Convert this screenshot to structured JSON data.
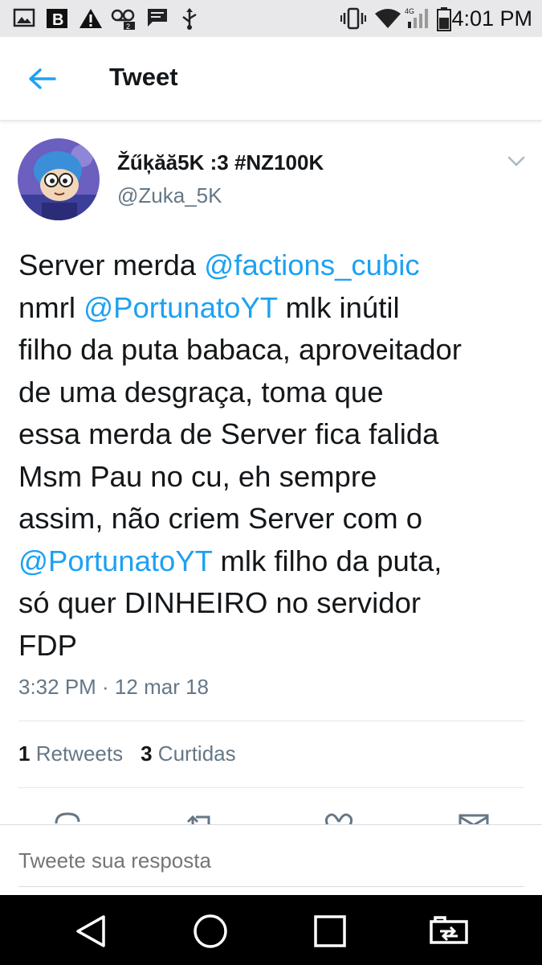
{
  "status_bar": {
    "time": "4:01 PM",
    "network_label": "4G",
    "left_icons": [
      "image-icon",
      "b-app-icon",
      "warning-icon",
      "voicemail-icon",
      "message-icon",
      "usb-icon"
    ],
    "right_icons": [
      "vibrate-icon",
      "wifi-icon",
      "signal-icon",
      "battery-icon"
    ]
  },
  "header": {
    "title": "Tweet",
    "back_icon": "arrow-left-icon",
    "accent_color": "#1da1f2"
  },
  "tweet": {
    "display_name": "Žűķăă5K :3 #NZ100K",
    "handle": "@Zuka_5K",
    "text": {
      "l1a": "Server merda ",
      "l1m": "@factions_cubic",
      "l2a": "nmrl ",
      "l2m": "@PortunatoYT",
      "l2b": " mlk inútil",
      "l3": "filho da puta babaca, aproveitador",
      "l4": "de uma desgraça, toma que",
      "l5": "essa merda de Server fica falida",
      "l6": "Msm Pau no cu, eh sempre",
      "l7": "assim, não criem Server com o",
      "l8m": "@PortunatoYT",
      "l8b": " mlk filho da puta,",
      "l9": "só quer DINHEIRO no servidor",
      "l10": "FDP"
    },
    "timestamp": "3:32 PM · 12 mar 18",
    "retweets_count": "1",
    "retweets_label": "Retweets",
    "likes_count": "3",
    "likes_label": "Curtidas"
  },
  "actions": [
    "reply-icon",
    "retweet-icon",
    "like-icon",
    "share-icon"
  ],
  "reply": {
    "placeholder": "Tweete sua resposta"
  },
  "nav": [
    "back-triangle-icon",
    "home-circle-icon",
    "recents-square-icon",
    "screen-switch-icon"
  ]
}
